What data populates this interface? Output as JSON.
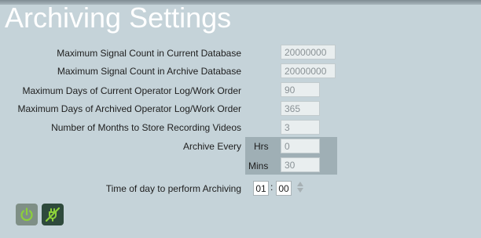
{
  "page": {
    "title": "Archiving Settings"
  },
  "settings": {
    "signal_current": {
      "label": "Maximum Signal Count in Current Database",
      "value": "20000000"
    },
    "signal_archive": {
      "label": "Maximum Signal Count in Archive Database",
      "value": "20000000"
    },
    "days_current": {
      "label": "Maximum Days of Current Operator Log/Work Order",
      "value": "90"
    },
    "days_archived": {
      "label": "Maximum Days of Archived Operator Log/Work Order",
      "value": "365"
    },
    "months_videos": {
      "label": "Number of Months to Store Recording Videos",
      "value": "3"
    }
  },
  "archive_every": {
    "label": "Archive Every",
    "hrs_label": "Hrs",
    "hrs_value": "0",
    "mins_label": "Mins",
    "mins_value": "30"
  },
  "time_of_day": {
    "label": "Time of day to perform Archiving",
    "hour": "01",
    "separator": ":",
    "minute": "00"
  },
  "actions": [
    {
      "icon": "power-icon"
    },
    {
      "icon": "power-plug-off-icon"
    }
  ],
  "colors": {
    "background": "#c5d3d9",
    "title": "#ffffff",
    "panel": "#9fafb5",
    "button1": "#7f8f86",
    "button2": "#2f4a3c",
    "icon_green": "#8cd03a"
  }
}
